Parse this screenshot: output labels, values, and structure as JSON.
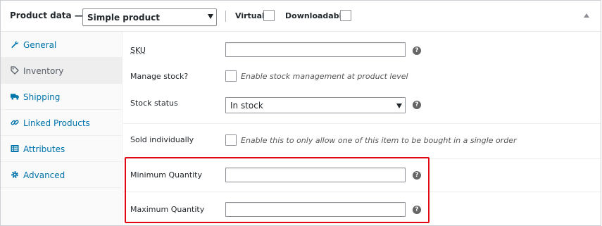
{
  "header": {
    "title": "Product data —",
    "product_type": "Simple product",
    "virtual_label": "Virtual:",
    "downloadable_label": "Downloadable:"
  },
  "sidebar": {
    "tabs": [
      {
        "label": "General",
        "icon": "wrench-icon",
        "active": false
      },
      {
        "label": "Inventory",
        "icon": "tag-icon",
        "active": true
      },
      {
        "label": "Shipping",
        "icon": "truck-icon",
        "active": false
      },
      {
        "label": "Linked Products",
        "icon": "link-icon",
        "active": false
      },
      {
        "label": "Attributes",
        "icon": "list-icon",
        "active": false
      },
      {
        "label": "Advanced",
        "icon": "gear-icon",
        "active": false
      }
    ]
  },
  "inventory": {
    "sku_label": "SKU",
    "sku_value": "",
    "manage_stock_label": "Manage stock?",
    "manage_stock_desc": "Enable stock management at product level",
    "stock_status_label": "Stock status",
    "stock_status_value": "In stock",
    "sold_individually_label": "Sold individually",
    "sold_individually_desc": "Enable this to only allow one of this item to be bought in a single order",
    "min_qty_label": "Minimum Quantity",
    "min_qty_value": "",
    "max_qty_label": "Maximum Quantity",
    "max_qty_value": "",
    "help_glyph": "?"
  },
  "colors": {
    "link": "#0073aa",
    "highlight": "#e30613"
  }
}
